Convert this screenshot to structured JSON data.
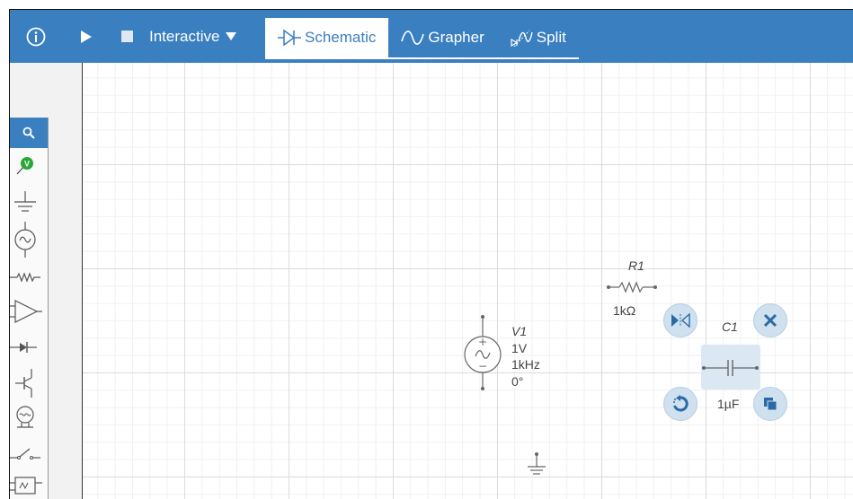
{
  "toolbar": {
    "info_icon": "info-circle-icon",
    "run_icon": "play-icon",
    "stop_icon": "stop-icon",
    "mode_label": "Interactive",
    "mode_icon": "caret-down-icon",
    "tabs": [
      {
        "label": "Schematic",
        "icon": "diode-icon",
        "active": true
      },
      {
        "label": "Grapher",
        "icon": "sine-wave-icon",
        "active": false
      },
      {
        "label": "Split",
        "icon": "split-icon",
        "active": false
      }
    ]
  },
  "palette": {
    "items": [
      {
        "name": "search-icon"
      },
      {
        "name": "voltage-probe-icon"
      },
      {
        "name": "ground-icon"
      },
      {
        "name": "ac-voltage-source-icon"
      },
      {
        "name": "resistor-icon"
      },
      {
        "name": "op-amp-icon"
      },
      {
        "name": "diode-icon"
      },
      {
        "name": "transistor-icon"
      },
      {
        "name": "lamp-icon"
      },
      {
        "name": "switch-icon"
      },
      {
        "name": "relay-icon"
      }
    ]
  },
  "schematic": {
    "v1": {
      "name": "V1",
      "amplitude": "1V",
      "frequency": "1kHz",
      "phase": "0°"
    },
    "r1": {
      "name": "R1",
      "value": "1kΩ"
    },
    "c1": {
      "name": "C1",
      "value": "1µF"
    }
  },
  "context_menu": {
    "flip": "flip-icon",
    "delete": "close-icon",
    "rotate": "rotate-icon",
    "duplicate": "duplicate-icon"
  },
  "colors": {
    "toolbar_bg": "#3a7fc0",
    "probe_green": "#2aa836",
    "action_button_bg": "#cfe0ee",
    "action_icon": "#2a6aa8",
    "selection_bg": "#dbe8f3"
  }
}
